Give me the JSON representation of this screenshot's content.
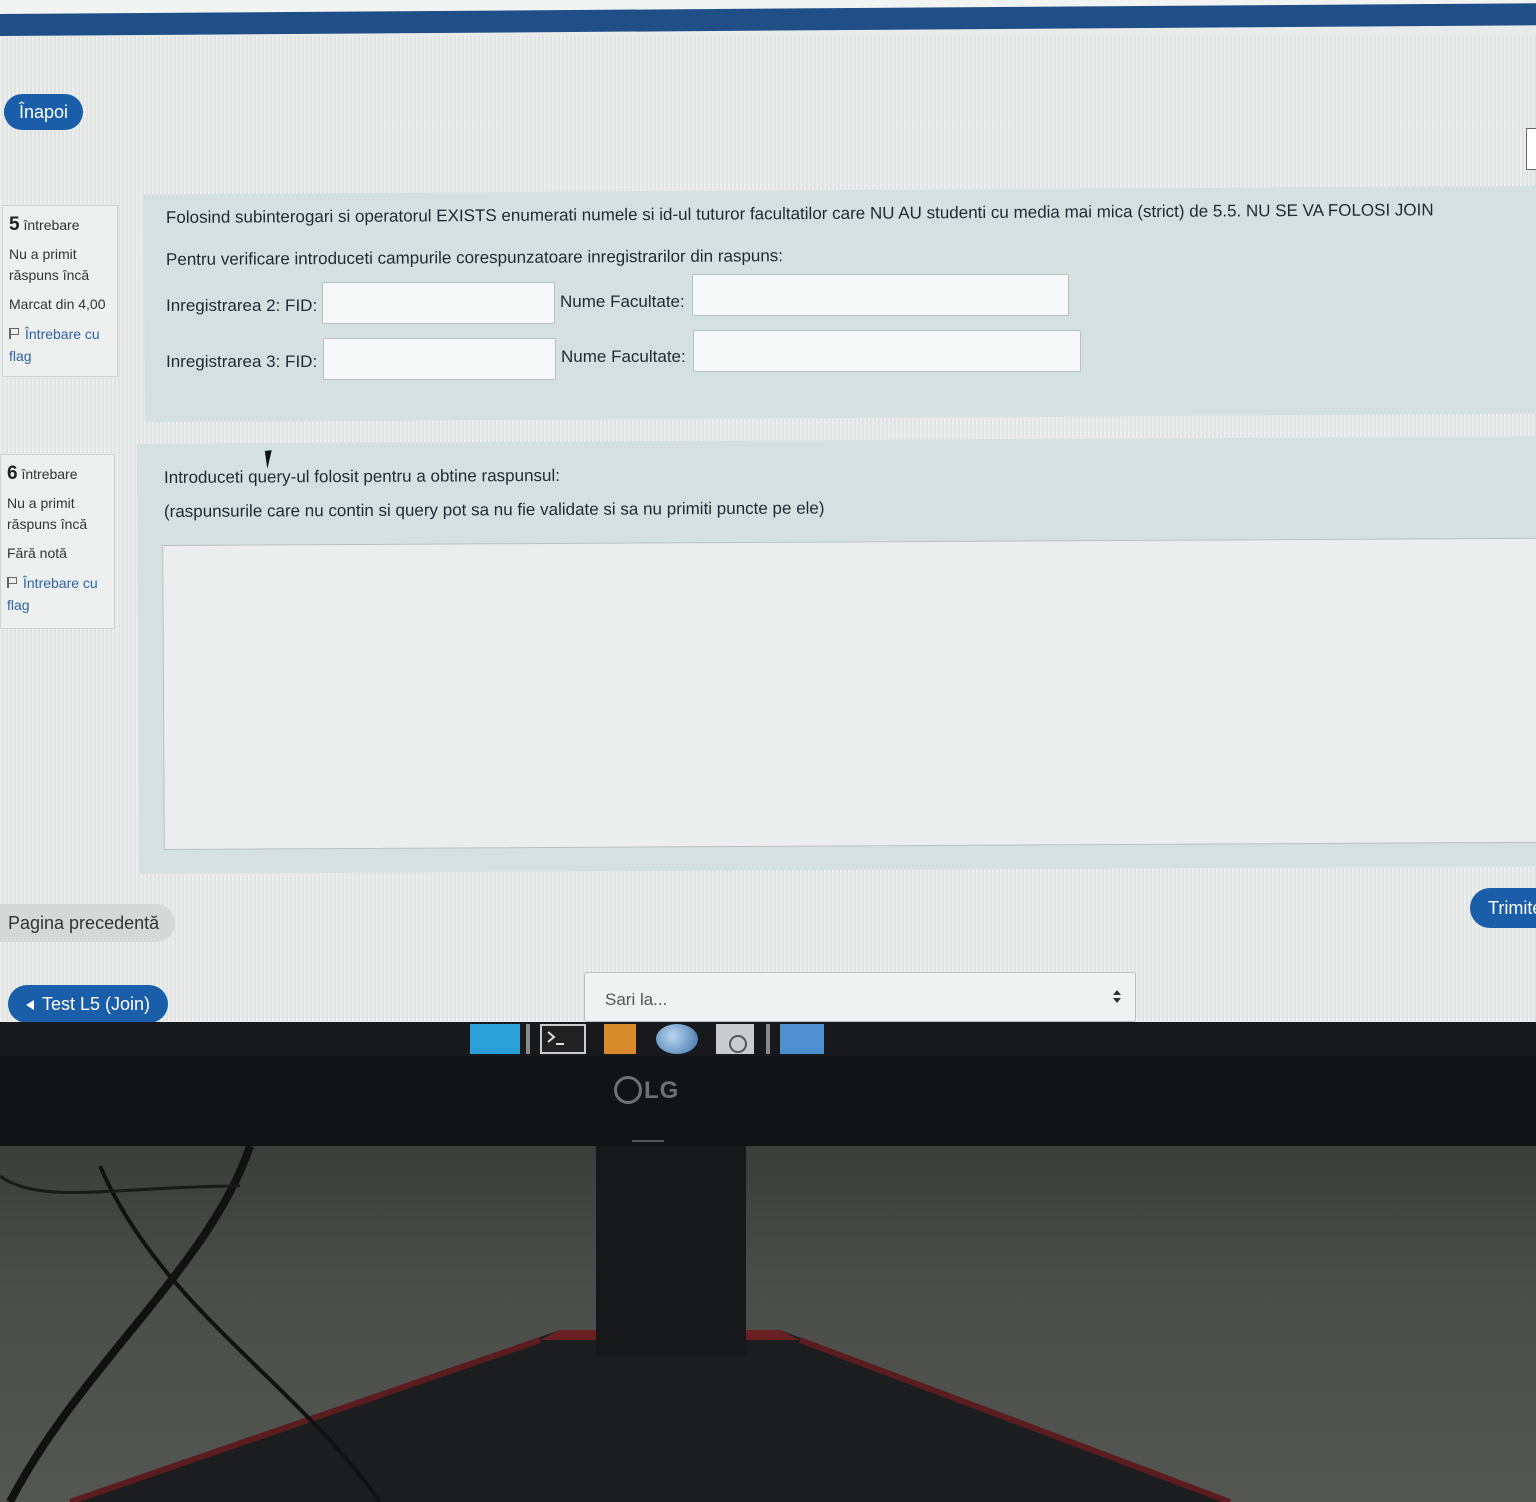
{
  "header": {
    "back_label": "Înapoi"
  },
  "question5": {
    "number": "5",
    "label": "întrebare",
    "status": "Nu a primit răspuns încă",
    "mark": "Marcat din 4,00",
    "flag_label": "Întrebare cu flag",
    "text_line1": "Folosind subinterogari si operatorul EXISTS enumerati numele si id-ul tuturor facultatilor care NU AU studenti cu media mai mica (strict) de 5.5. NU SE VA FOLOSI JOIN",
    "text_line2": "Pentru verificare introduceti campurile corespunzatoare inregistrarilor din raspuns:",
    "row2_fid_label": "Inregistrarea 2: FID:",
    "row2_name_label": "Nume Facultate:",
    "row3_fid_label": "Inregistrarea 3: FID:",
    "row3_name_label": "Nume Facultate:"
  },
  "question6": {
    "number": "6",
    "label": "întrebare",
    "status": "Nu a primit răspuns încă",
    "mark": "Fără notă",
    "flag_label": "Întrebare cu flag",
    "text_line1": "Introduceti query-ul folosit pentru a obtine raspunsul:",
    "text_line2": "(raspunsurile care nu contin si query pot sa nu fie validate si sa nu primiti puncte pe ele)"
  },
  "footer": {
    "prev_label": "Pagina precedentă",
    "submit_label": "Trimite",
    "test_link_label": "Test L5 (Join)",
    "jump_placeholder": "Sari la..."
  },
  "monitor": {
    "brand": "LG"
  },
  "taskbar": {
    "icons": [
      "window-icon",
      "terminal-icon",
      "archive-icon",
      "browser-globe-icon",
      "disc-icon",
      "folder-icon"
    ]
  },
  "colors": {
    "accent": "#1a5da8",
    "question_box": "#d5e1e1",
    "nav_bar": "#1f4f86"
  }
}
